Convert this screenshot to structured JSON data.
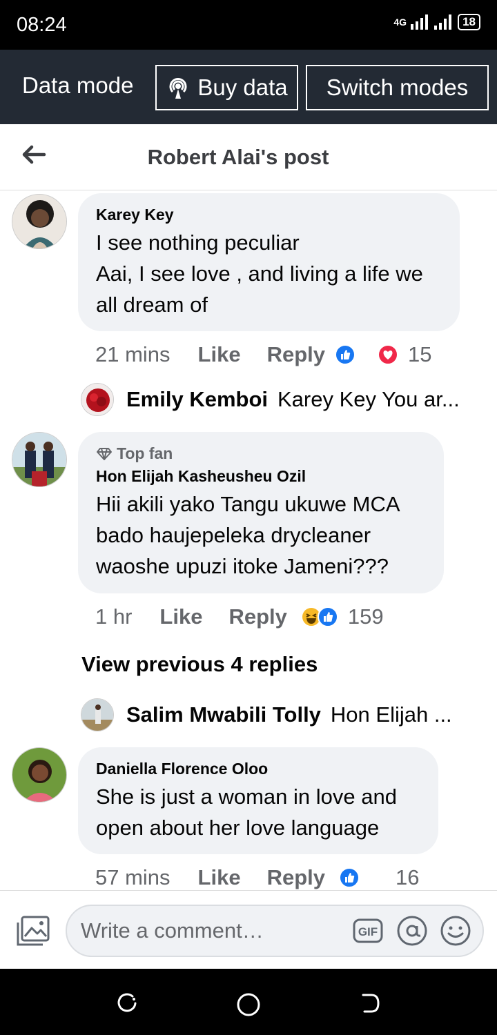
{
  "status": {
    "time": "08:24",
    "network": "4G",
    "battery": "18"
  },
  "data_bar": {
    "mode_label": "Data mode",
    "buy_data_label": "Buy data",
    "switch_modes_label": "Switch modes"
  },
  "header": {
    "title": "Robert Alai's post"
  },
  "comments": [
    {
      "author": "Karey Key",
      "text": "I see nothing peculiar\nAai, I see love , and living a life we all dream of",
      "time": "21 mins",
      "like_label": "Like",
      "reply_label": "Reply",
      "reactions": [
        "like",
        "love"
      ],
      "reaction_count": "15",
      "reply_preview": {
        "author": "Emily Kemboi",
        "text": "Karey Key You ar..."
      }
    },
    {
      "badge": "Top fan",
      "author": "Hon Elijah Kasheusheu Ozil",
      "text": "Hii akili yako Tangu ukuwe MCA bado haujepeleka drycleaner waoshe upuzi itoke  Jameni???",
      "time": "1 hr",
      "like_label": "Like",
      "reply_label": "Reply",
      "reactions": [
        "haha",
        "like"
      ],
      "reaction_count": "159",
      "view_previous": "View previous 4 replies",
      "reply_preview": {
        "author": "Salim Mwabili Tolly",
        "text": "Hon Elijah ..."
      }
    },
    {
      "author": "Daniella Florence Oloo",
      "text": "She is just a woman in love and open about her love language",
      "time": "57 mins",
      "like_label": "Like",
      "reply_label": "Reply",
      "reactions": [
        "like"
      ],
      "reaction_count": "16"
    }
  ],
  "composer": {
    "placeholder": "Write a comment…",
    "gif_label": "GIF"
  },
  "colors": {
    "accent": "#1877f2",
    "love": "#f02849",
    "haha": "#f7b928",
    "bubble": "#f0f2f5",
    "data_bar": "#232a34"
  }
}
